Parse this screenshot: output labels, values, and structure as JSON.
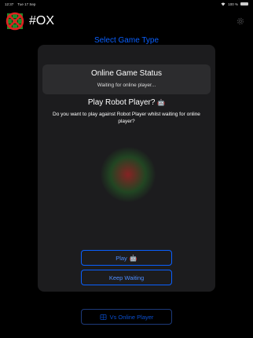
{
  "status_bar": {
    "time": "12:37",
    "date": "Tue 17 Sep",
    "battery_text": "100 %",
    "battery_level": 1.0,
    "icons": [
      "wifi-icon",
      "battery-icon"
    ]
  },
  "header": {
    "title": "#OX",
    "logo_icon": "tic-tac-toe-logo-icon",
    "settings_icon": "gear-icon"
  },
  "screen": {
    "select_title": "Select Game Type"
  },
  "modal": {
    "status_title": "Online Game Status",
    "status_text": "Waiting for online player...",
    "robot_title": "Play Robot Player?",
    "robot_emoji": "🤖",
    "robot_desc": "Do you want to play against Robot Player whilst waiting for online player?",
    "play_label": "Play",
    "play_emoji": "🤖",
    "keep_waiting_label": "Keep Waiting"
  },
  "bottom": {
    "online_button_label": "Vs Online Player",
    "online_button_icon": "online-player-icon"
  },
  "colors": {
    "accent": "#0a60ff",
    "modal_bg": "#1c1c1e",
    "card_bg": "#2c2c2e",
    "logo_red": "#e02020",
    "logo_green": "#1f8a2a"
  }
}
